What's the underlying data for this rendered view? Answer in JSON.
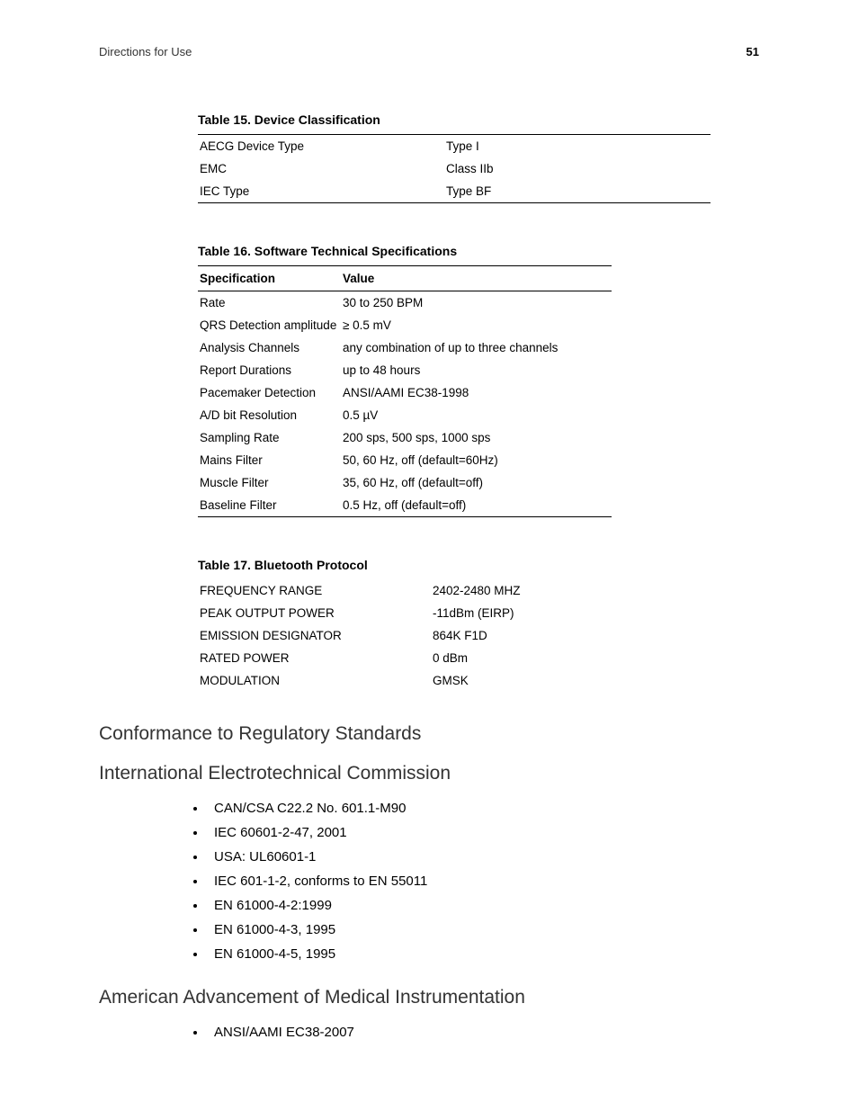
{
  "header": {
    "title": "Directions for Use",
    "page": "51"
  },
  "table15": {
    "caption": "Table 15.  Device Classification",
    "rows": [
      {
        "label": "AECG Device Type",
        "value": "Type I"
      },
      {
        "label": "EMC",
        "value": "Class IIb"
      },
      {
        "label": "IEC Type",
        "value": "Type BF"
      }
    ]
  },
  "table16": {
    "caption": "Table 16.  Software Technical Specifications",
    "header": {
      "col1": "Specification",
      "col2": "Value"
    },
    "rows": [
      {
        "label": "Rate",
        "value": "30 to 250 BPM"
      },
      {
        "label": "QRS Detection amplitude",
        "value": "≥ 0.5 mV"
      },
      {
        "label": "Analysis Channels",
        "value": "any combination of up to three channels"
      },
      {
        "label": "Report Durations",
        "value": "up to 48 hours"
      },
      {
        "label": "Pacemaker Detection",
        "value": "ANSI/AAMI EC38-1998"
      },
      {
        "label": "A/D bit Resolution",
        "value": "0.5 µV"
      },
      {
        "label": "Sampling Rate",
        "value": "200 sps, 500 sps, 1000 sps"
      },
      {
        "label": "Mains Filter",
        "value": "50, 60 Hz, off (default=60Hz)"
      },
      {
        "label": "Muscle Filter",
        "value": "35, 60 Hz, off (default=off)"
      },
      {
        "label": "Baseline Filter",
        "value": "0.5 Hz, off (default=off)"
      }
    ]
  },
  "table17": {
    "caption": "Table 17.  Bluetooth Protocol",
    "rows": [
      {
        "label": "FREQUENCY RANGE",
        "value": "2402-2480 MHZ"
      },
      {
        "label": "PEAK OUTPUT POWER",
        "value": "-11dBm (EIRP)"
      },
      {
        "label": "EMISSION DESIGNATOR",
        "value": "864K F1D"
      },
      {
        "label": "RATED POWER",
        "value": "0 dBm"
      },
      {
        "label": "MODULATION",
        "value": "GMSK"
      }
    ]
  },
  "sections": {
    "conformance": "Conformance to Regulatory Standards",
    "iec": "International Electrotechnical Commission",
    "iec_items": [
      "CAN/CSA C22.2 No. 601.1-M90",
      "IEC 60601-2-47, 2001",
      "USA: UL60601-1",
      "IEC 601-1-2, conforms to EN 55011",
      "EN 61000-4-2:1999",
      "EN 61000-4-3, 1995",
      "EN 61000-4-5, 1995"
    ],
    "aami": "American Advancement of Medical Instrumentation",
    "aami_items": [
      "ANSI/AAMI EC38-2007"
    ]
  }
}
